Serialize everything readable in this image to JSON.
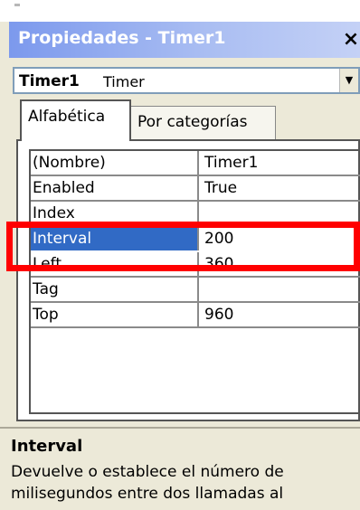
{
  "window": {
    "title": "Propiedades - Timer1",
    "close_glyph": "×"
  },
  "object_selector": {
    "name": "Timer1",
    "type": "Timer",
    "dropdown_glyph": "▼"
  },
  "tabs": [
    {
      "label": "Alfabética",
      "active": true
    },
    {
      "label": "Por categorías",
      "active": false
    }
  ],
  "properties": [
    {
      "name": "(Nombre)",
      "value": "Timer1"
    },
    {
      "name": "Enabled",
      "value": "True"
    },
    {
      "name": "Index",
      "value": ""
    },
    {
      "name": "Interval",
      "value": "200",
      "selected": true
    },
    {
      "name": "Left",
      "value": "360"
    },
    {
      "name": "Tag",
      "value": ""
    },
    {
      "name": "Top",
      "value": "960"
    }
  ],
  "description": {
    "title": "Interval",
    "text": "Devuelve o establece el número de milisegundos entre dos llamadas al"
  },
  "colors": {
    "selection": "#316ac5",
    "highlight": "#ff0000",
    "title_gradient_start": "#7c99ed"
  }
}
